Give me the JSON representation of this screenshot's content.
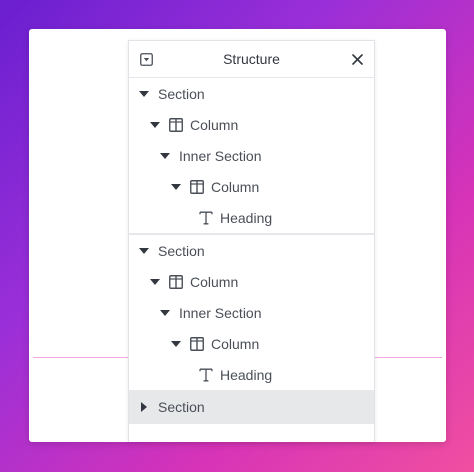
{
  "panel": {
    "title": "Structure"
  },
  "tree": {
    "group1": {
      "section": "Section",
      "column": "Column",
      "inner_section": "Inner Section",
      "inner_column": "Column",
      "heading": "Heading"
    },
    "group2": {
      "section": "Section",
      "column": "Column",
      "inner_section": "Inner Section",
      "inner_column": "Column",
      "heading": "Heading"
    },
    "group3": {
      "section": "Section"
    }
  },
  "icons": {
    "collapse": "collapse-panel-icon",
    "close": "close-icon",
    "caret_down": "caret-down-icon",
    "caret_right": "caret-right-icon",
    "column": "column-layout-icon",
    "heading": "text-heading-icon"
  },
  "colors": {
    "highlight": "#e7e8ea",
    "text": "#4a4f57",
    "guide_line": "#f2a6e6"
  }
}
